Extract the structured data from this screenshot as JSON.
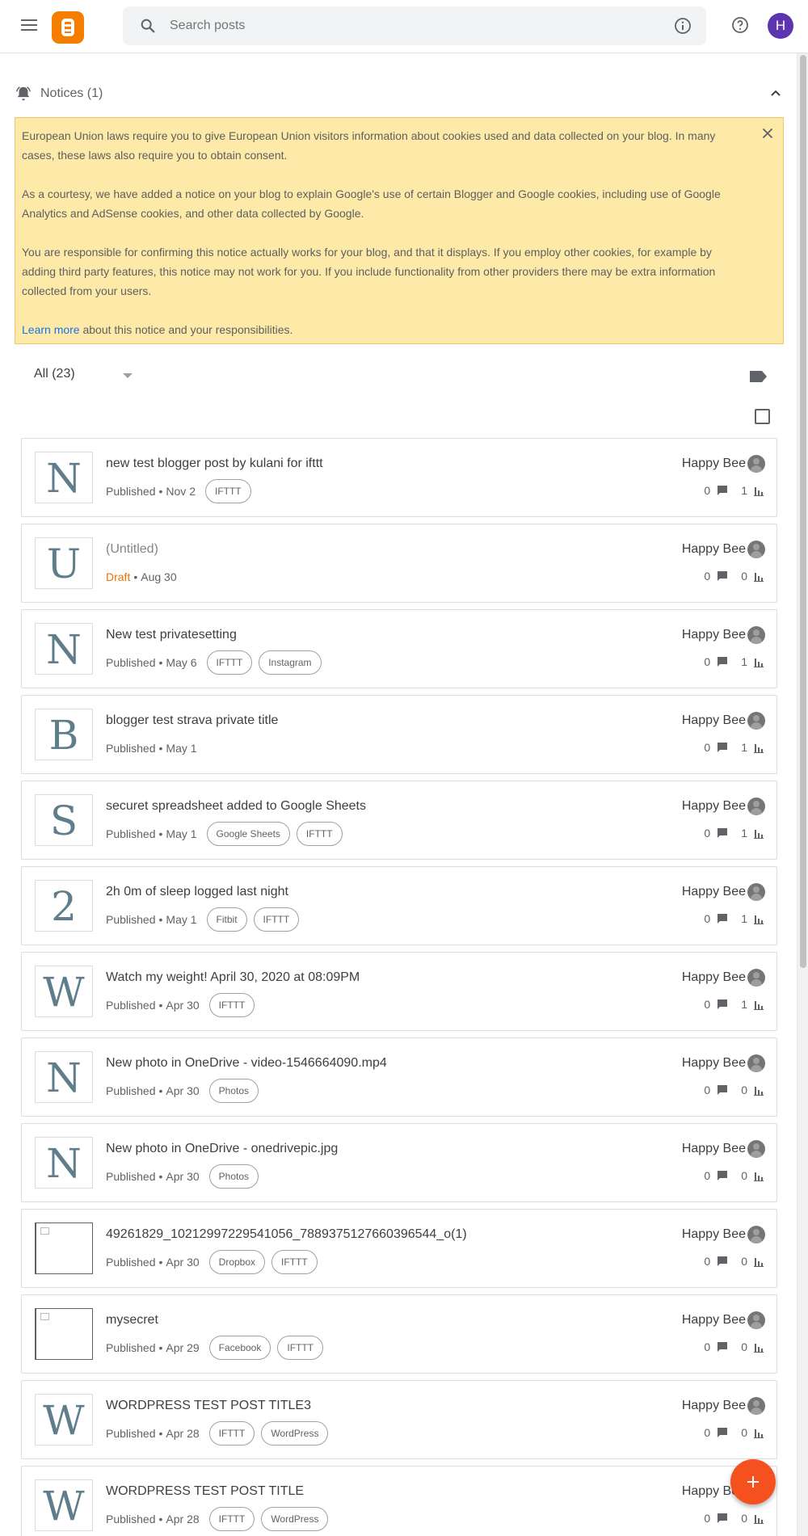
{
  "header": {
    "search_placeholder": "Search posts",
    "avatar_letter": "H",
    "brand_color": "#f57d00",
    "avatar_color": "#5e35b1"
  },
  "notices": {
    "label": "Notices (1)",
    "paragraph1": "European Union laws require you to give European Union visitors information about cookies used and data collected on your blog. In many cases, these laws also require you to obtain consent.",
    "paragraph2": "As a courtesy, we have added a notice on your blog to explain Google's use of certain Blogger and Google cookies, including use of Google Analytics and AdSense cookies, and other data collected by Google.",
    "paragraph3": "You are responsible for confirming this notice actually works for your blog, and that it displays. If you employ other cookies, for example by adding third party features, this notice may not work for you. If you include functionality from other providers there may be extra information collected from your users.",
    "learn_more": "Learn more",
    "learn_more_suffix": " about this notice and your responsibilities."
  },
  "filter": {
    "label": "All (23)"
  },
  "posts": [
    {
      "letter": "N",
      "title": "new test blogger post by kulani for ifttt",
      "status": "Published",
      "date": "Nov 2",
      "tags": [
        "IFTTT"
      ],
      "author": "Happy Bee",
      "comments": "0",
      "views": "1"
    },
    {
      "letter": "U",
      "title": "(Untitled)",
      "status": "Draft",
      "date": "Aug 30",
      "tags": [],
      "author": "Happy Bee",
      "comments": "0",
      "views": "0",
      "draft": true,
      "untitled": true
    },
    {
      "letter": "N",
      "title": "New test privatesetting",
      "status": "Published",
      "date": "May 6",
      "tags": [
        "IFTTT",
        "Instagram"
      ],
      "author": "Happy Bee",
      "comments": "0",
      "views": "1"
    },
    {
      "letter": "B",
      "title": "blogger test strava private title",
      "status": "Published",
      "date": "May 1",
      "tags": [],
      "author": "Happy Bee",
      "comments": "0",
      "views": "1"
    },
    {
      "letter": "S",
      "title": "securet spreadsheet added to Google Sheets",
      "status": "Published",
      "date": "May 1",
      "tags": [
        "Google Sheets",
        "IFTTT"
      ],
      "author": "Happy Bee",
      "comments": "0",
      "views": "1"
    },
    {
      "letter": "2",
      "title": "2h 0m of sleep logged last night",
      "status": "Published",
      "date": "May 1",
      "tags": [
        "Fitbit",
        "IFTTT"
      ],
      "author": "Happy Bee",
      "comments": "0",
      "views": "1"
    },
    {
      "letter": "W",
      "title": "Watch my weight! April 30, 2020 at 08:09PM",
      "status": "Published",
      "date": "Apr 30",
      "tags": [
        "IFTTT"
      ],
      "author": "Happy Bee",
      "comments": "0",
      "views": "1"
    },
    {
      "letter": "N",
      "title": "New photo in OneDrive - video-1546664090.mp4",
      "status": "Published",
      "date": "Apr 30",
      "tags": [
        "Photos"
      ],
      "author": "Happy Bee",
      "comments": "0",
      "views": "0"
    },
    {
      "letter": "N",
      "title": "New photo in OneDrive - onedrivepic.jpg",
      "status": "Published",
      "date": "Apr 30",
      "tags": [
        "Photos"
      ],
      "author": "Happy Bee",
      "comments": "0",
      "views": "0"
    },
    {
      "letter": "",
      "broken": true,
      "title": "49261829_10212997229541056_7889375127660396544_o(1)",
      "status": "Published",
      "date": "Apr 30",
      "tags": [
        "Dropbox",
        "IFTTT"
      ],
      "author": "Happy Bee",
      "comments": "0",
      "views": "0"
    },
    {
      "letter": "",
      "broken": true,
      "title": "mysecret",
      "status": "Published",
      "date": "Apr 29",
      "tags": [
        "Facebook",
        "IFTTT"
      ],
      "author": "Happy Bee",
      "comments": "0",
      "views": "0"
    },
    {
      "letter": "W",
      "title": "WORDPRESS TEST POST TITLE3",
      "status": "Published",
      "date": "Apr 28",
      "tags": [
        "IFTTT",
        "WordPress"
      ],
      "author": "Happy Bee",
      "comments": "0",
      "views": "0"
    },
    {
      "letter": "W",
      "title": "WORDPRESS TEST POST TITLE",
      "status": "Published",
      "date": "Apr 28",
      "tags": [
        "IFTTT",
        "WordPress"
      ],
      "author": "Happy Bee",
      "comments": "0",
      "views": "0"
    }
  ],
  "fab": {
    "icon": "plus-icon",
    "color": "#f4511e"
  }
}
